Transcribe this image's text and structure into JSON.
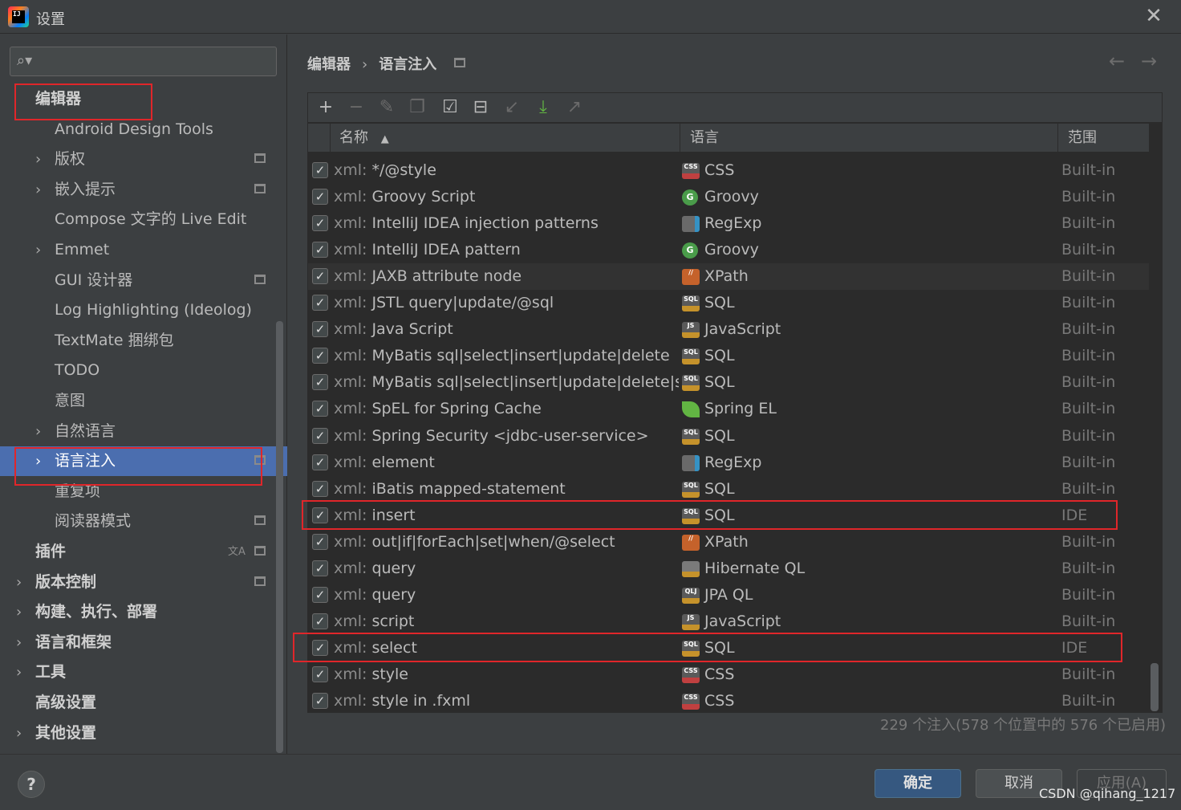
{
  "window": {
    "title": "设置",
    "app_icon_text": "IJ"
  },
  "sidebar": {
    "search_placeholder": "",
    "items": [
      {
        "label": "编辑器",
        "bold": true,
        "level": 0
      },
      {
        "label": "Android Design Tools",
        "level": 1
      },
      {
        "label": "版权",
        "level": 1,
        "arrow": true
      },
      {
        "label": "嵌入提示",
        "level": 1,
        "arrow": true
      },
      {
        "label": "Compose 文字的 Live Edit",
        "level": 1
      },
      {
        "label": "Emmet",
        "level": 1,
        "arrow": true
      },
      {
        "label": "GUI 设计器",
        "level": 1
      },
      {
        "label": "Log Highlighting (Ideolog)",
        "level": 1
      },
      {
        "label": "TextMate 捆绑包",
        "level": 1
      },
      {
        "label": "TODO",
        "level": 1
      },
      {
        "label": "意图",
        "level": 1
      },
      {
        "label": "自然语言",
        "level": 1,
        "arrow": true
      },
      {
        "label": "语言注入",
        "level": 1,
        "arrow": true,
        "selected": true
      },
      {
        "label": "重复项",
        "level": 1
      },
      {
        "label": "阅读器模式",
        "level": 1
      },
      {
        "label": "插件",
        "bold": true,
        "level": 0
      },
      {
        "label": "版本控制",
        "bold": true,
        "level": 0,
        "arrow": true
      },
      {
        "label": "构建、执行、部署",
        "bold": true,
        "level": 0,
        "arrow": true
      },
      {
        "label": "语言和框架",
        "bold": true,
        "level": 0,
        "arrow": true
      },
      {
        "label": "工具",
        "bold": true,
        "level": 0,
        "arrow": true
      },
      {
        "label": "高级设置",
        "bold": true,
        "level": 0
      },
      {
        "label": "其他设置",
        "bold": true,
        "level": 0,
        "arrow": true
      }
    ]
  },
  "breadcrumb": {
    "parent": "编辑器",
    "separator": "›",
    "current": "语言注入"
  },
  "table": {
    "columns": {
      "name": "名称",
      "sort_indicator": "▲",
      "language": "语言",
      "scope": "范围"
    },
    "rows": [
      {
        "prefix": "xml:",
        "name": "*/@style",
        "lang": "CSS",
        "icon": "css",
        "icon_text": "CSS",
        "scope": "Built-in",
        "checked": true
      },
      {
        "prefix": "xml:",
        "name": "Groovy Script",
        "lang": "Groovy",
        "icon": "groovy",
        "icon_text": "G",
        "scope": "Built-in",
        "checked": true
      },
      {
        "prefix": "xml:",
        "name": "IntelliJ IDEA injection patterns",
        "lang": "RegExp",
        "icon": "regexp",
        "icon_text": "",
        "scope": "Built-in",
        "checked": true
      },
      {
        "prefix": "xml:",
        "name": "IntelliJ IDEA pattern",
        "lang": "Groovy",
        "icon": "groovy",
        "icon_text": "G",
        "scope": "Built-in",
        "checked": true
      },
      {
        "prefix": "xml:",
        "name": "JAXB attribute node",
        "lang": "XPath",
        "icon": "xpath",
        "icon_text": "//",
        "scope": "Built-in",
        "checked": true,
        "highlight": true
      },
      {
        "prefix": "xml:",
        "name": "JSTL query|update/@sql",
        "lang": "SQL",
        "icon": "sql",
        "icon_text": "SQL",
        "scope": "Built-in",
        "checked": true
      },
      {
        "prefix": "xml:",
        "name": "Java Script",
        "lang": "JavaScript",
        "icon": "js",
        "icon_text": "JS",
        "scope": "Built-in",
        "checked": true
      },
      {
        "prefix": "xml:",
        "name": "MyBatis sql|select|insert|update|delete",
        "lang": "SQL",
        "icon": "sql",
        "icon_text": "SQL",
        "scope": "Built-in",
        "checked": true
      },
      {
        "prefix": "xml:",
        "name": "MyBatis sql|select|insert|update|delete|statem",
        "lang": "SQL",
        "icon": "sql",
        "icon_text": "SQL",
        "scope": "Built-in",
        "checked": true
      },
      {
        "prefix": "xml:",
        "name": "SpEL for Spring Cache",
        "lang": "Spring EL",
        "icon": "spring",
        "icon_text": "",
        "scope": "Built-in",
        "checked": true
      },
      {
        "prefix": "xml:",
        "name": "Spring Security <jdbc-user-service>",
        "lang": "SQL",
        "icon": "sql",
        "icon_text": "SQL",
        "scope": "Built-in",
        "checked": true
      },
      {
        "prefix": "xml:",
        "name": "element",
        "lang": "RegExp",
        "icon": "regexp",
        "icon_text": "",
        "scope": "Built-in",
        "checked": true
      },
      {
        "prefix": "xml:",
        "name": "iBatis mapped-statement",
        "lang": "SQL",
        "icon": "sql",
        "icon_text": "SQL",
        "scope": "Built-in",
        "checked": true
      },
      {
        "prefix": "xml:",
        "name": "insert",
        "lang": "SQL",
        "icon": "sql",
        "icon_text": "SQL",
        "scope": "IDE",
        "checked": true
      },
      {
        "prefix": "xml:",
        "name": "out|if|forEach|set|when/@select",
        "lang": "XPath",
        "icon": "xpath",
        "icon_text": "//",
        "scope": "Built-in",
        "checked": true
      },
      {
        "prefix": "xml:",
        "name": "query",
        "lang": "Hibernate QL",
        "icon": "hql",
        "icon_text": "",
        "scope": "Built-in",
        "checked": true
      },
      {
        "prefix": "xml:",
        "name": "query",
        "lang": "JPA QL",
        "icon": "qlj",
        "icon_text": "QLJ",
        "scope": "Built-in",
        "checked": true
      },
      {
        "prefix": "xml:",
        "name": "script",
        "lang": "JavaScript",
        "icon": "js",
        "icon_text": "JS",
        "scope": "Built-in",
        "checked": true
      },
      {
        "prefix": "xml:",
        "name": "select",
        "lang": "SQL",
        "icon": "sql",
        "icon_text": "SQL",
        "scope": "IDE",
        "checked": true
      },
      {
        "prefix": "xml:",
        "name": "style",
        "lang": "CSS",
        "icon": "css",
        "icon_text": "CSS",
        "scope": "Built-in",
        "checked": true
      },
      {
        "prefix": "xml:",
        "name": "style in .fxml",
        "lang": "CSS",
        "icon": "css",
        "icon_text": "CSS",
        "scope": "Built-in",
        "checked": true
      }
    ]
  },
  "status_text": "229 个注入(578 个位置中的 576 个已启用)",
  "buttons": {
    "ok": "确定",
    "cancel": "取消",
    "apply": "应用(A)",
    "help": "?"
  },
  "watermark": "CSDN @qihang_1217",
  "colors": {
    "selection": "#4b6eaf",
    "annotation_red": "#e0262a",
    "primary_button": "#365880"
  }
}
